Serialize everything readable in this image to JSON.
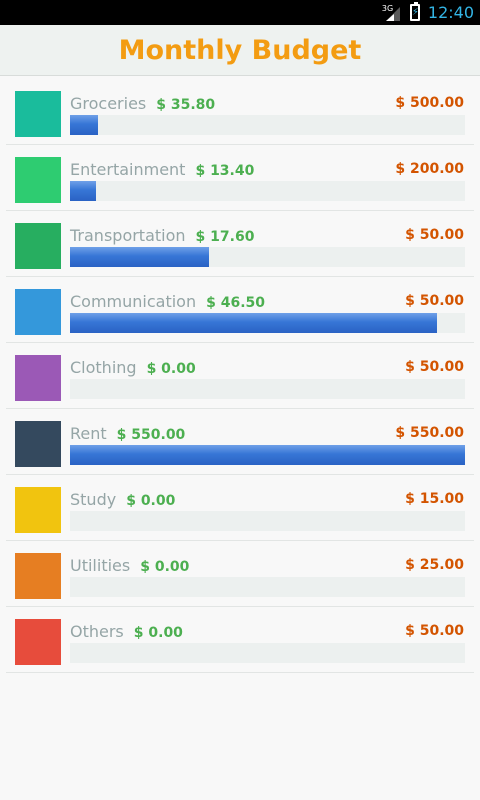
{
  "status_bar": {
    "network": "3G",
    "time": "12:40"
  },
  "header": {
    "title": "Monthly Budget"
  },
  "colors": {
    "title": "#f39c12",
    "spent": "#4caf50",
    "budget": "#d35400",
    "label": "#95a5a6",
    "bar": "#2f6dcf"
  },
  "categories": [
    {
      "name": "Groceries",
      "spent": "$ 35.80",
      "budget": "$ 500.00",
      "progress": 0.072,
      "color": "#1abc9c"
    },
    {
      "name": "Entertainment",
      "spent": "$ 13.40",
      "budget": "$ 200.00",
      "progress": 0.067,
      "color": "#2ecc71"
    },
    {
      "name": "Transportation",
      "spent": "$ 17.60",
      "budget": "$ 50.00",
      "progress": 0.352,
      "color": "#27ae60"
    },
    {
      "name": "Communication",
      "spent": "$ 46.50",
      "budget": "$ 50.00",
      "progress": 0.93,
      "color": "#3498db"
    },
    {
      "name": "Clothing",
      "spent": "$ 0.00",
      "budget": "$ 50.00",
      "progress": 0,
      "color": "#9b59b6"
    },
    {
      "name": "Rent",
      "spent": "$ 550.00",
      "budget": "$ 550.00",
      "progress": 1.0,
      "color": "#34495e"
    },
    {
      "name": "Study",
      "spent": "$ 0.00",
      "budget": "$ 15.00",
      "progress": 0,
      "color": "#f1c40f"
    },
    {
      "name": "Utilities",
      "spent": "$ 0.00",
      "budget": "$ 25.00",
      "progress": 0,
      "color": "#e67e22"
    },
    {
      "name": "Others",
      "spent": "$ 0.00",
      "budget": "$ 50.00",
      "progress": 0,
      "color": "#e74c3c"
    }
  ]
}
